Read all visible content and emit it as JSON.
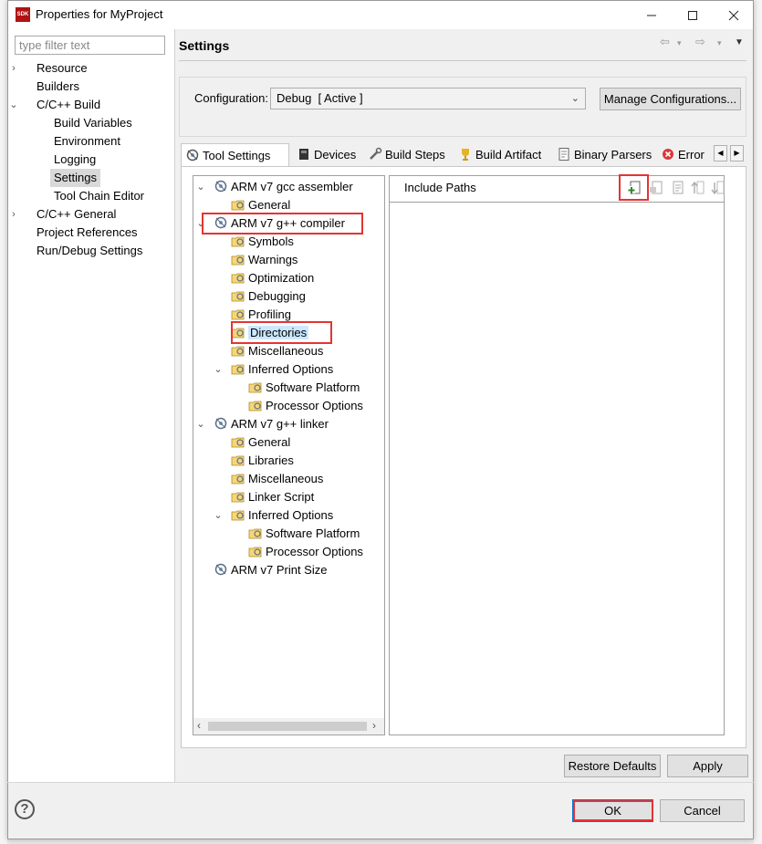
{
  "window": {
    "title": "Properties for MyProject",
    "icon_label": "SDK",
    "controls": [
      "minimize-icon",
      "maximize-icon",
      "close-icon"
    ]
  },
  "left_nav": {
    "filter_placeholder": "type filter text",
    "items": [
      {
        "label": "Resource",
        "level": 0,
        "twisty": "collapsed"
      },
      {
        "label": "Builders",
        "level": 0,
        "twisty": "none"
      },
      {
        "label": "C/C++ Build",
        "level": 0,
        "twisty": "expanded"
      },
      {
        "label": "Build Variables",
        "level": 1,
        "twisty": "none"
      },
      {
        "label": "Environment",
        "level": 1,
        "twisty": "none"
      },
      {
        "label": "Logging",
        "level": 1,
        "twisty": "none"
      },
      {
        "label": "Settings",
        "level": 1,
        "twisty": "none",
        "selected": true
      },
      {
        "label": "Tool Chain Editor",
        "level": 1,
        "twisty": "none"
      },
      {
        "label": "C/C++ General",
        "level": 0,
        "twisty": "collapsed"
      },
      {
        "label": "Project References",
        "level": 0,
        "twisty": "none"
      },
      {
        "label": "Run/Debug Settings",
        "level": 0,
        "twisty": "none"
      }
    ]
  },
  "main": {
    "title": "Settings",
    "configuration_label": "Configuration:",
    "configuration_value": "Debug  [ Active ]",
    "manage_button": "Manage Configurations...",
    "tabs": [
      {
        "label": "Tool Settings",
        "icon": "gear-icon",
        "active": true
      },
      {
        "label": "Devices",
        "icon": "chip-icon"
      },
      {
        "label": "Build Steps",
        "icon": "tools-icon"
      },
      {
        "label": "Build Artifact",
        "icon": "trophy-icon"
      },
      {
        "label": "Binary Parsers",
        "icon": "binary-file-icon"
      },
      {
        "label": "Error",
        "icon": "error-icon"
      }
    ],
    "tool_tree": {
      "assembler": {
        "label": "ARM v7 gcc assembler",
        "children": [
          "General"
        ]
      },
      "compiler": {
        "label": "ARM v7 g++ compiler",
        "children": [
          "Symbols",
          "Warnings",
          "Optimization",
          "Debugging",
          "Profiling",
          "Directories",
          "Miscellaneous"
        ],
        "inferred_label": "Inferred Options",
        "inferred_children": [
          "Software Platform",
          "Processor Options"
        ]
      },
      "linker": {
        "label": "ARM v7 g++ linker",
        "children": [
          "General",
          "Libraries",
          "Miscellaneous",
          "Linker Script"
        ],
        "inferred_label": "Inferred Options",
        "inferred_children": [
          "Software Platform",
          "Processor Options"
        ]
      },
      "print_size": {
        "label": "ARM v7 Print Size"
      },
      "selected": "Directories"
    },
    "include_paths": {
      "label": "Include Paths",
      "toolbar": [
        "add-icon",
        "add-workspace-icon",
        "edit-icon",
        "move-up-icon",
        "move-down-icon"
      ]
    }
  },
  "footer": {
    "restore_defaults": "Restore Defaults",
    "apply": "Apply",
    "ok": "OK",
    "cancel": "Cancel"
  },
  "colors": {
    "highlight": "#e53333",
    "selection": "#cce8ff",
    "default_button_border": "#0078d7"
  }
}
